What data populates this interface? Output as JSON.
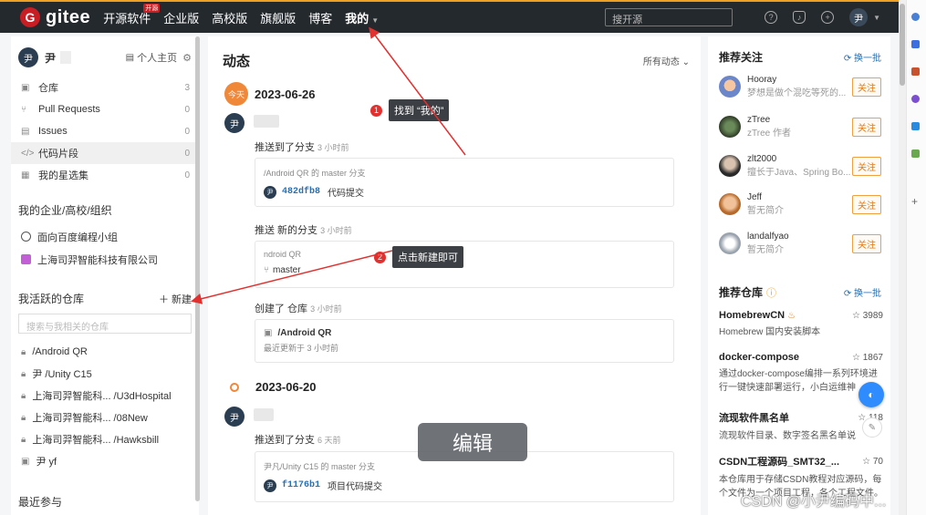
{
  "nav": {
    "logo_mark": "G",
    "logo_text": "gitee",
    "items": [
      {
        "label": "开源软件",
        "badge": "开源"
      },
      {
        "label": "企业版"
      },
      {
        "label": "高校版"
      },
      {
        "label": "旗舰版"
      },
      {
        "label": "博客"
      },
      {
        "label": "我的"
      }
    ],
    "search_placeholder": "搜开源",
    "avatar": "尹"
  },
  "sidebar": {
    "user_avatar": "尹",
    "user_name": "尹",
    "homepage_label": "个人主页",
    "menu": [
      {
        "label": "仓库",
        "count": "3"
      },
      {
        "label": "Pull Requests",
        "count": "0"
      },
      {
        "label": "Issues",
        "count": "0"
      },
      {
        "label": "代码片段",
        "count": "0"
      },
      {
        "label": "我的星选集",
        "count": "0"
      }
    ],
    "orgs_title": "我的企业/高校/组织",
    "orgs": [
      "面向百度编程小组",
      "上海司羿智能科技有限公司"
    ],
    "repos_title": "我活跃的仓库",
    "new_label": "新建",
    "repo_search_placeholder": "搜索与我相关的仓库",
    "repos": [
      "/Android QR",
      "尹 /Unity C15",
      "上海司羿智能科... /U3dHospital",
      "上海司羿智能科... /08New",
      "上海司羿智能科... /Hawksbill",
      "尹 yf"
    ],
    "recent_title": "最近参与"
  },
  "feed": {
    "title": "动态",
    "filter": "所有动态",
    "today_badge": "今天",
    "days": [
      {
        "date": "2023-06-26",
        "events": [
          {
            "action": "推送到了分支",
            "ago": "3 小时前",
            "line1": "/Android QR 的 master 分支",
            "sha": "482dfb8",
            "message": "代码提交"
          },
          {
            "action": "推送 新的分支",
            "ago": "3 小时前",
            "line1": "ndroid QR",
            "branch": "master"
          },
          {
            "action": "创建了 仓库",
            "ago": "3 小时前",
            "repo": "/Android QR",
            "updated": "最近更新于 3 小时前"
          }
        ]
      },
      {
        "date": "2023-06-20",
        "events": [
          {
            "action": "推送到了分支",
            "ago": "6 天前",
            "line1": "尹凡/Unity C15 的 master 分支",
            "sha": "f1176b1",
            "message": "项目代码提交"
          }
        ]
      }
    ]
  },
  "recommend_users": {
    "title": "推荐关注",
    "refresh": "换一批",
    "follow_label": "关注",
    "users": [
      {
        "name": "Hooray",
        "desc": "梦想是做个混吃等死的..."
      },
      {
        "name": "zTree",
        "desc": "zTree 作者"
      },
      {
        "name": "zlt2000",
        "desc": "擅长于Java、Spring Bo..."
      },
      {
        "name": "Jeff",
        "desc": "暂无简介"
      },
      {
        "name": "landalfyao",
        "desc": "暂无简介"
      }
    ]
  },
  "recommend_repos": {
    "title": "推荐仓库",
    "refresh": "换一批",
    "repos": [
      {
        "name": "HomebrewCN",
        "stars": "3989",
        "desc": "Homebrew 国内安装脚本"
      },
      {
        "name": "docker-compose",
        "stars": "1867",
        "desc": "通过docker-compose编排一系列环境进行一键快速部署运行，小白运维神"
      },
      {
        "name": "流现软件黑名单",
        "stars": "118",
        "desc": "流现软件目录、数字签名黑名单说"
      },
      {
        "name": "CSDN工程源码_SMT32_...",
        "stars": "70",
        "desc": "本仓库用于存储CSDN教程对应源码，每个文件为一个项目工程，各个工程文件。"
      }
    ]
  },
  "annotations": {
    "step1_num": "1",
    "step1_text": "找到 “我的”",
    "step2_num": "2",
    "step2_text": "点击新建即可",
    "edit_overlay": "编辑",
    "watermark": "CSDN @小尹编码中..."
  }
}
